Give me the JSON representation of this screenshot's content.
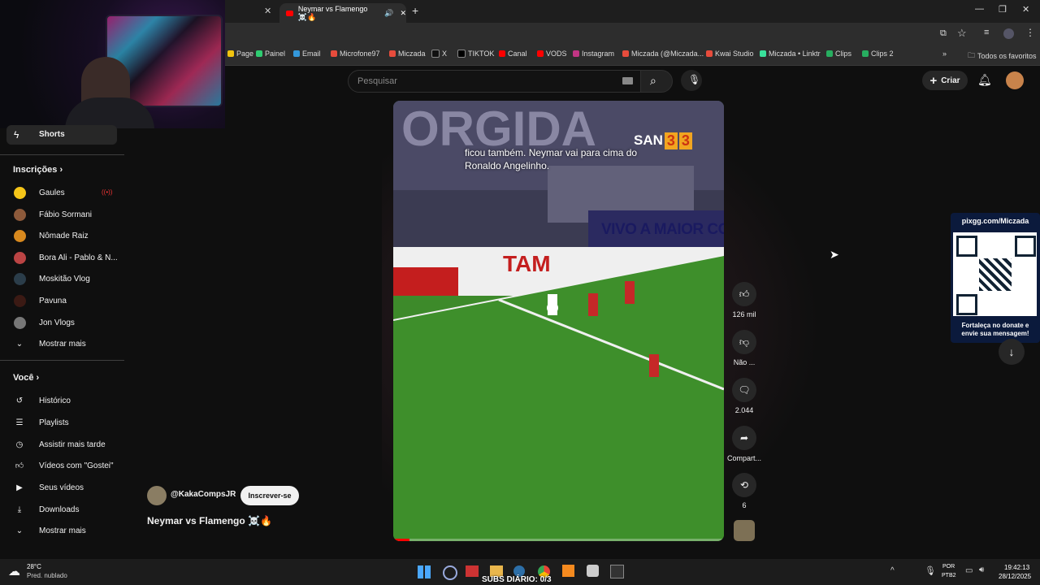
{
  "browser": {
    "tabs": [
      {
        "label": "Neymar vs Flamengo ☠️🔥",
        "active": true
      }
    ],
    "bookmarks": [
      "Page",
      "Painel",
      "Email",
      "Microfone97",
      "Miczada",
      "X",
      "TIKTOK",
      "Canal",
      "VODS",
      "Instagram",
      "Miczada (@Miczada...",
      "Kwai Studio",
      "Miczada • Linktr",
      "Clips",
      "Clips 2"
    ],
    "all_bookmarks": "Todos os favoritos"
  },
  "header": {
    "search_placeholder": "Pesquisar",
    "create_label": "Criar"
  },
  "sidebar": {
    "shorts": "Shorts",
    "subs_title": "Inscrições",
    "subs": [
      {
        "name": "Gaules",
        "live": true
      },
      {
        "name": "Fábio Sormani"
      },
      {
        "name": "Nômade Raiz"
      },
      {
        "name": "Bora Ali - Pablo & N..."
      },
      {
        "name": "Moskitão Vlog"
      },
      {
        "name": "Pavuna"
      },
      {
        "name": "Jon Vlogs"
      }
    ],
    "show_more": "Mostrar mais",
    "you_title": "Você",
    "you_items": [
      "Histórico",
      "Playlists",
      "Assistir mais tarde",
      "Vídeos com \"Gostei\"",
      "Seus vídeos",
      "Downloads",
      "Mostrar mais"
    ]
  },
  "short": {
    "channel": "@KakaCompsJR",
    "subscribe": "Inscrever-se",
    "title": "Neymar vs Flamengo ☠️🔥",
    "caption_line1": "ficou também. Neymar vai para cima do",
    "caption_line2": "Ronaldo Angelinho.",
    "score_team": "SAN",
    "score_home": "3",
    "score_away": "3",
    "banner": "VIVO A MAIOR COBER",
    "sponsor": "TAM",
    "likes": "126 mil",
    "dislike_label": "Não ...",
    "comments": "2.044",
    "share": "Compart...",
    "remix": "6"
  },
  "overlay": {
    "url": "pixgg.com/Miczada",
    "donate_text": "Fortaleça no donate e envie sua mensagem!"
  },
  "taskbar": {
    "temp": "28°C",
    "weather": "Pred. nublado",
    "subs_text": "SUBS DIÁRIO: 0/3",
    "lang1": "POR",
    "lang2": "PTB2",
    "time": "19:42:13",
    "date": "28/12/2025"
  }
}
